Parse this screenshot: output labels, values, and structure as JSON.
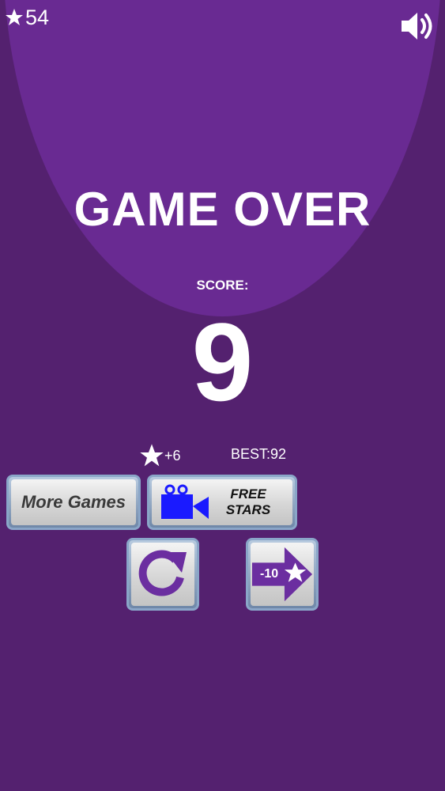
{
  "hud": {
    "stars_total": "54"
  },
  "game_over": {
    "title": "GAME OVER",
    "score_label": "SCORE:",
    "score_value": "9",
    "stars_earned": "+6",
    "best_label": "BEST:92"
  },
  "buttons": {
    "more_games": "More Games",
    "free_stars_line1": "FREE",
    "free_stars_line2": "STARS",
    "skip_cost": "-10"
  },
  "icons": {
    "star": "star-icon",
    "sound": "speaker-icon",
    "camera": "video-camera-icon",
    "restart": "restart-icon",
    "skip": "arrow-right-icon"
  },
  "colors": {
    "background": "#54216f",
    "spotlight": "#692a92",
    "accent_purple": "#6b2ea0",
    "camera_blue": "#1a1aff"
  }
}
